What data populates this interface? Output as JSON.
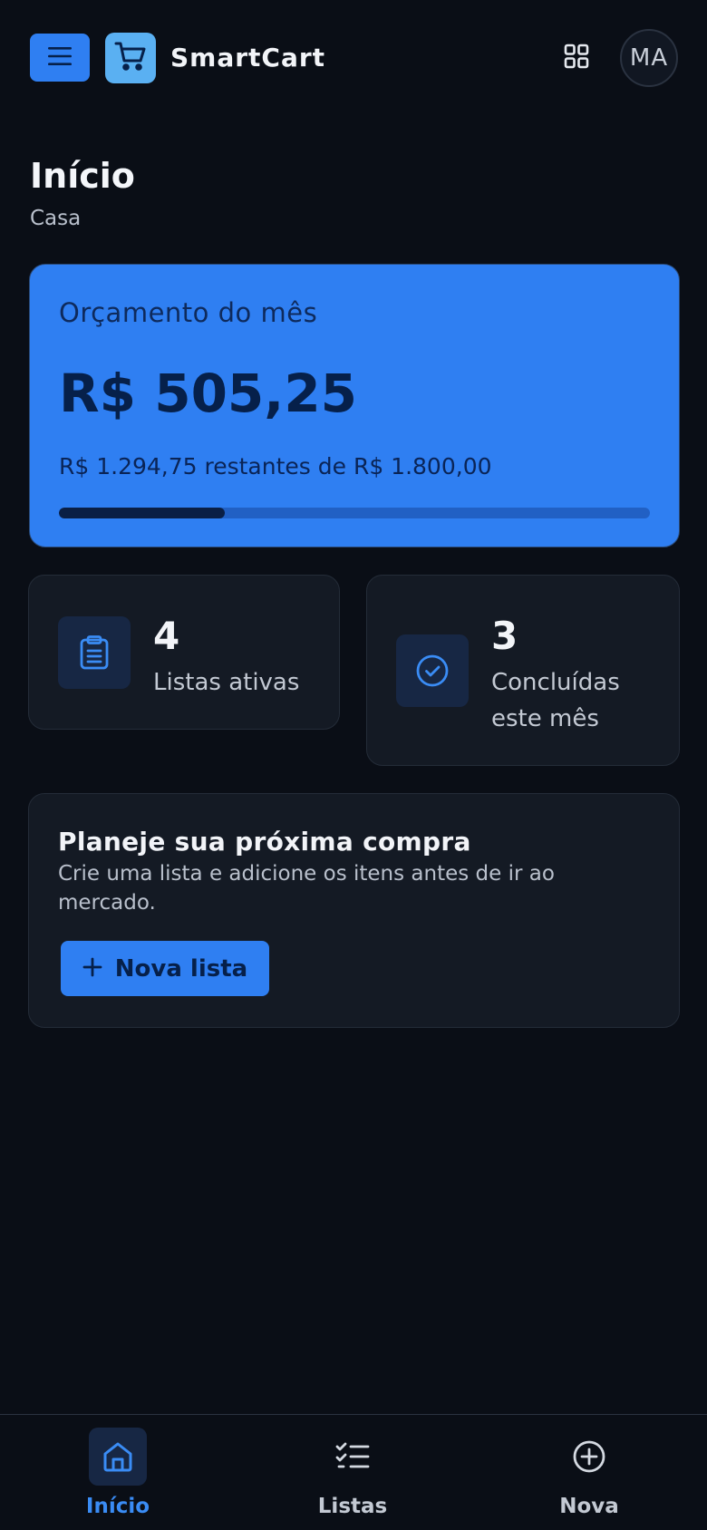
{
  "app": {
    "brand": "SmartCart",
    "avatar_initials": "MA",
    "accent_color": "#2f7ff2",
    "background_color": "#0a0e16"
  },
  "header": {
    "menu_icon": "menu-icon",
    "logo_icon": "shopping-cart-icon",
    "apps_icon": "grid-icon"
  },
  "page": {
    "title": "Início",
    "subtitle": "Casa"
  },
  "budget": {
    "label": "Orçamento do mês",
    "amount": "R$ 505,25",
    "remaining_text": "R$ 1.294,75 restantes de R$ 1.800,00",
    "progress_fraction": 0.2807
  },
  "stats": [
    {
      "value": "4",
      "label": "Listas ativas",
      "icon": "clipboard-icon"
    },
    {
      "value": "3",
      "label": "Concluídas este mês",
      "icon": "check-circle-icon"
    }
  ],
  "plan": {
    "title": "Planeje sua próxima compra",
    "description": "Crie uma lista e adicione os itens antes de ir ao mercado.",
    "button_label": "Nova lista",
    "button_icon": "plus-icon"
  },
  "bottom_nav": [
    {
      "label": "Início",
      "icon": "home-icon",
      "active": true
    },
    {
      "label": "Listas",
      "icon": "checklist-icon",
      "active": false
    },
    {
      "label": "Nova",
      "icon": "plus-circle-icon",
      "active": false
    }
  ]
}
